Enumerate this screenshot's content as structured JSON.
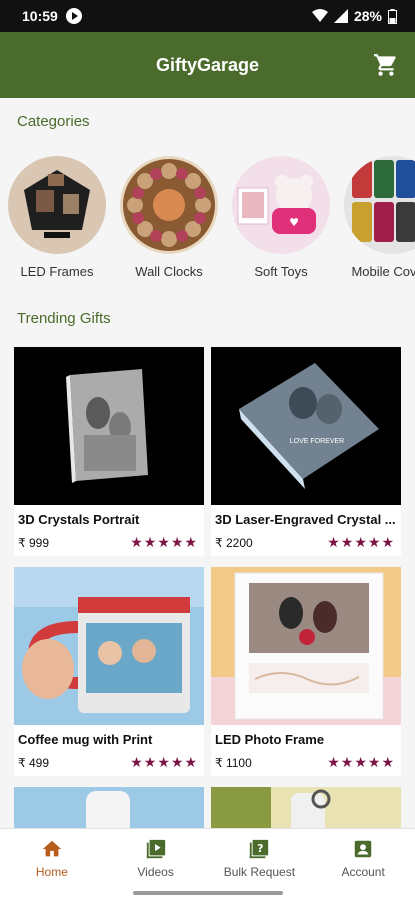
{
  "status_bar": {
    "time": "10:59",
    "battery": "28%"
  },
  "app_bar": {
    "title": "GiftyGarage",
    "cart_icon": "cart-icon"
  },
  "sections": {
    "categories": "Categories",
    "trending": "Trending Gifts"
  },
  "categories": [
    {
      "label": "LED Frames"
    },
    {
      "label": "Wall Clocks"
    },
    {
      "label": "Soft Toys"
    },
    {
      "label": "Mobile Covers"
    }
  ],
  "products": [
    {
      "name": "3D Crystals Portrait",
      "price": "₹ 999",
      "rating": "★★★★★"
    },
    {
      "name": "3D Laser-Engraved Crystal ...",
      "price": "₹ 2200",
      "rating": "★★★★★"
    },
    {
      "name": "Coffee mug with Print",
      "price": "₹ 499",
      "rating": "★★★★★"
    },
    {
      "name": "LED Photo Frame",
      "price": "₹ 1100",
      "rating": "★★★★★"
    }
  ],
  "bottom_nav": [
    {
      "label": "Home",
      "icon": "home-icon",
      "active": true
    },
    {
      "label": "Videos",
      "icon": "video-icon",
      "active": false
    },
    {
      "label": "Bulk Request",
      "icon": "bulk-request-icon",
      "active": false
    },
    {
      "label": "Account",
      "icon": "account-icon",
      "active": false
    }
  ],
  "colors": {
    "primary": "#4a6b2b",
    "star": "#7b1545",
    "active_nav": "#b85c1e"
  }
}
